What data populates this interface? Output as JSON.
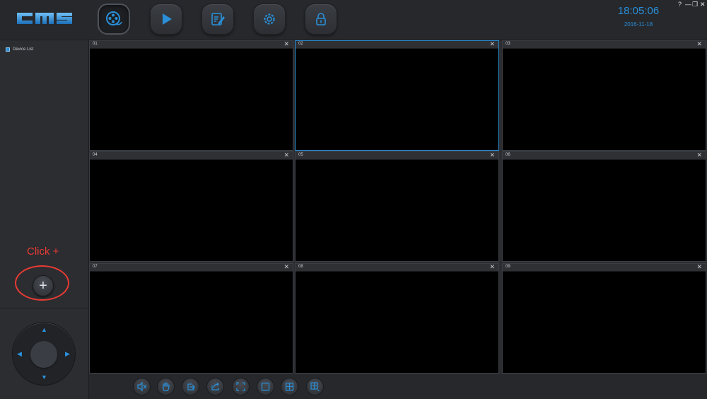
{
  "app": {
    "logo_text": "CMS",
    "accent": "#2a8fd8"
  },
  "header": {
    "time": "18:05:06",
    "date": "2016-11-18",
    "nav": [
      {
        "name": "preview-icon",
        "active": true
      },
      {
        "name": "playback-icon",
        "active": false
      },
      {
        "name": "log-icon",
        "active": false
      },
      {
        "name": "settings-icon",
        "active": false
      },
      {
        "name": "lock-icon",
        "active": false
      }
    ],
    "window_controls": {
      "help": "?",
      "minimize": "—",
      "restore": "❐",
      "close": "✕"
    }
  },
  "sidebar": {
    "device_list_label": "Device List",
    "annotation": "Click +",
    "add_label": "+",
    "ptz": {
      "up": "▲",
      "down": "▼",
      "left": "◀",
      "right": "▶"
    }
  },
  "grid": {
    "cells": [
      {
        "num": "01",
        "close": "✕"
      },
      {
        "num": "02",
        "close": "✕",
        "selected": true
      },
      {
        "num": "03",
        "close": "✕"
      },
      {
        "num": "04",
        "close": "✕"
      },
      {
        "num": "05",
        "close": "✕"
      },
      {
        "num": "06",
        "close": "✕"
      },
      {
        "num": "07",
        "close": "✕"
      },
      {
        "num": "08",
        "close": "✕"
      },
      {
        "num": "09",
        "close": "✕"
      }
    ]
  },
  "toolbar": {
    "buttons": [
      "mute-icon",
      "hand-icon",
      "export-icon",
      "share-icon",
      "fullscreen-icon",
      "single-view-icon",
      "quad-view-icon",
      "nine-view-icon"
    ]
  }
}
